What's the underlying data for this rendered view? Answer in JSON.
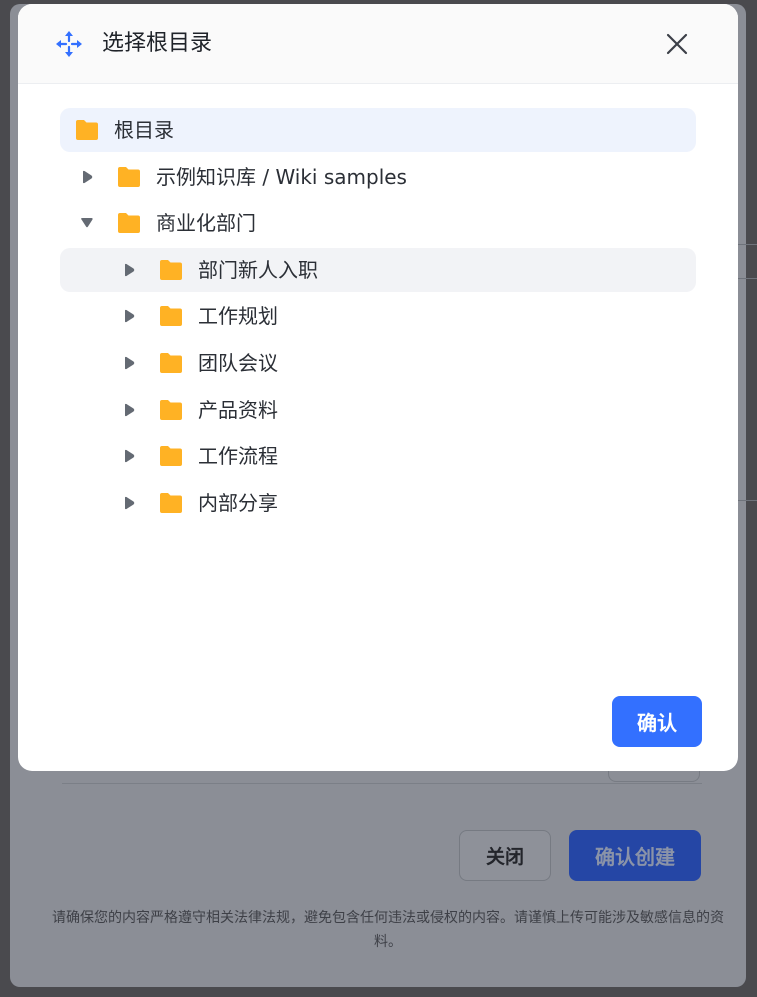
{
  "modal": {
    "title": "选择根目录",
    "confirm_label": "确认",
    "icons": {
      "header": "move-arrows-icon",
      "close": "close-icon",
      "folder": "folder-icon",
      "caret": "caret-icon"
    },
    "colors": {
      "accent": "#3370ff",
      "folder": "#ffb224",
      "selected_bg": "#eef3fd",
      "hover_bg": "#f2f3f6",
      "caret": "#646a73"
    }
  },
  "tree": [
    {
      "label": "根目录",
      "depth": 0,
      "expanded": null,
      "selected": true,
      "hovered": false
    },
    {
      "label": "示例知识库 / Wiki samples",
      "depth": 1,
      "expanded": false,
      "selected": false,
      "hovered": false
    },
    {
      "label": "商业化部门",
      "depth": 1,
      "expanded": true,
      "selected": false,
      "hovered": false
    },
    {
      "label": "部门新人入职",
      "depth": 2,
      "expanded": false,
      "selected": false,
      "hovered": true
    },
    {
      "label": "工作规划",
      "depth": 2,
      "expanded": false,
      "selected": false,
      "hovered": false
    },
    {
      "label": "团队会议",
      "depth": 2,
      "expanded": false,
      "selected": false,
      "hovered": false
    },
    {
      "label": "产品资料",
      "depth": 2,
      "expanded": false,
      "selected": false,
      "hovered": false
    },
    {
      "label": "工作流程",
      "depth": 2,
      "expanded": false,
      "selected": false,
      "hovered": false
    },
    {
      "label": "内部分享",
      "depth": 2,
      "expanded": false,
      "selected": false,
      "hovered": false
    }
  ],
  "background": {
    "close_label": "关闭",
    "create_label": "确认创建",
    "notice": "请确保您的内容严格遵守相关法律法规，避免包含任何违法或侵权的内容。请谨慎上传可能涉及敏感信息的资料。"
  }
}
